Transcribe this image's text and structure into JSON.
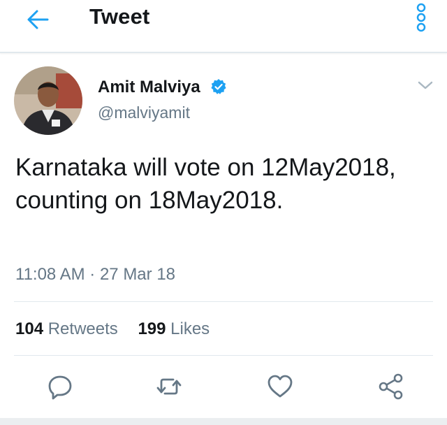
{
  "header": {
    "title": "Tweet",
    "back_icon": "arrow-left-icon",
    "overflow_icon": "more-vertical-icon"
  },
  "tweet": {
    "author": {
      "name": "Amit Malviya",
      "handle": "@malviyamit",
      "verified": true,
      "verified_icon": "verified-badge-icon"
    },
    "text": "Karnataka will vote on 12May2018, counting on 18May2018.",
    "timestamp": "11:08 AM · 27 Mar 18",
    "stats": {
      "retweets_count": "104",
      "retweets_label": "Retweets",
      "likes_count": "199",
      "likes_label": "Likes"
    }
  },
  "actions": [
    {
      "icon": "reply-icon"
    },
    {
      "icon": "retweet-icon"
    },
    {
      "icon": "like-icon"
    },
    {
      "icon": "share-icon"
    }
  ],
  "colors": {
    "accent": "#1da1f2",
    "text_primary": "#14171a",
    "text_secondary": "#657786",
    "divider": "#e1e8ed"
  }
}
